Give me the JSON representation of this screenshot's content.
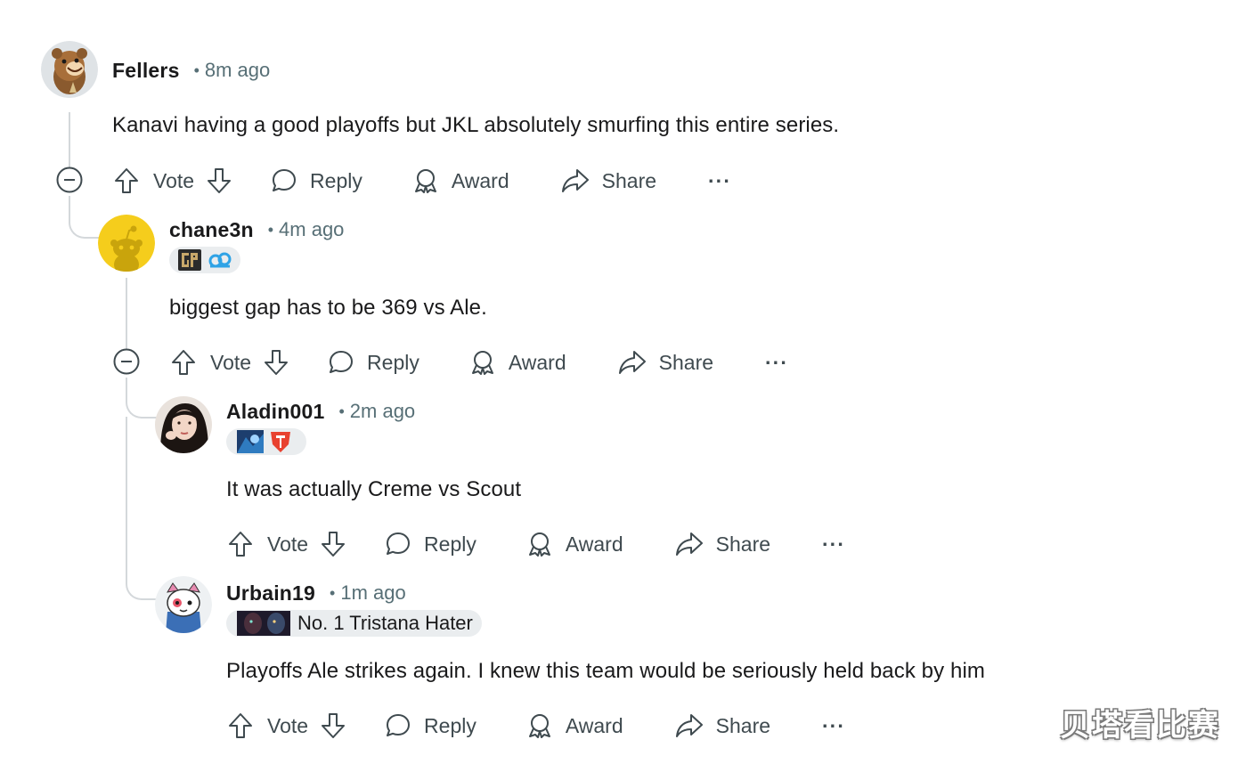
{
  "comments": [
    {
      "username": "Fellers",
      "time": "8m ago",
      "body": "Kanavi having a good playoffs but JKL absolutely smurfing this entire series.",
      "flair_text": "",
      "avatar": "bear-avatar-icon"
    },
    {
      "username": "chane3n",
      "time": "4m ago",
      "body": "biggest gap has to be 369 vs Ale.",
      "flair_text": "",
      "flair_icons": [
        "gen-g-logo-icon",
        "cloud9-logo-icon"
      ],
      "avatar": "snoo-yellow-avatar-icon"
    },
    {
      "username": "Aladin001",
      "time": "2m ago",
      "body": "It was actually Creme vs Scout",
      "flair_text": "",
      "flair_icons": [
        "champion-portrait-icon",
        "top-esports-logo-icon"
      ],
      "avatar": "photo-avatar-icon"
    },
    {
      "username": "Urbain19",
      "time": "1m ago",
      "body": "Playoffs Ale strikes again. I knew this team would be seriously held back by him",
      "flair_text": "No. 1 Tristana Hater",
      "flair_icons": [
        "champion-portrait-icon"
      ],
      "avatar": "snoo-costume-avatar-icon"
    }
  ],
  "actions": {
    "vote": "Vote",
    "reply": "Reply",
    "award": "Award",
    "share": "Share",
    "more": "···"
  },
  "watermark": "贝塔看比赛",
  "colors": {
    "text": "#1a1a1b",
    "meta": "#576f76",
    "action": "#3f4a4f",
    "thread": "#d4d8db",
    "flair_bg": "#eaedef"
  }
}
